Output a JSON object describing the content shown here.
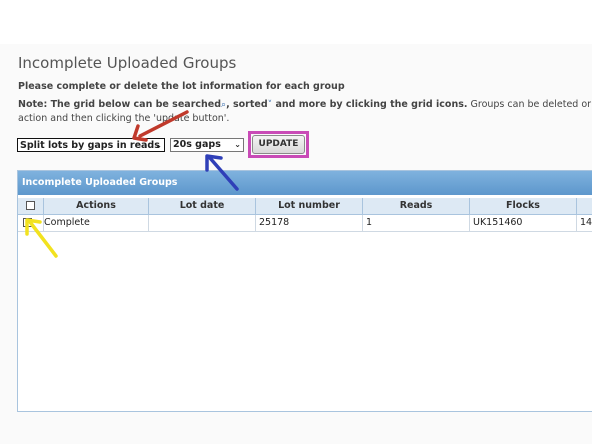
{
  "page": {
    "title": "Incomplete Uploaded Groups",
    "instruction": "Please complete or delete the lot information for each group",
    "note": {
      "prefix": "Note: The grid below can be searched",
      "mid1": ", sorted",
      "mid2": " and more by clicking the grid icons.",
      "tail": " Groups can be deleted or mer",
      "line2": "action and then clicking the 'update button'."
    }
  },
  "controls": {
    "split_select": "Split lots by gaps in reads",
    "gaps_select": "20s gaps",
    "update_label": "UPDATE"
  },
  "grid": {
    "caption": "Incomplete Uploaded Groups",
    "columns": [
      "Actions",
      "Lot date",
      "Lot number",
      "Reads",
      "Flocks"
    ],
    "rows": [
      {
        "action": "Complete",
        "lot_date": "",
        "lot_number": "25178",
        "reads": "1",
        "flocks": "UK151460",
        "extra": "14"
      }
    ]
  },
  "icons": {
    "search": "search-icon",
    "sort": "sort-icon",
    "chevron": "chevron-down-icon"
  },
  "annotation_colors": {
    "red_arrow": "#c0392b",
    "blue_arrow": "#2f3fb8",
    "yellow_arrow": "#f2e21f",
    "highlight_box": "#c94bb7"
  }
}
